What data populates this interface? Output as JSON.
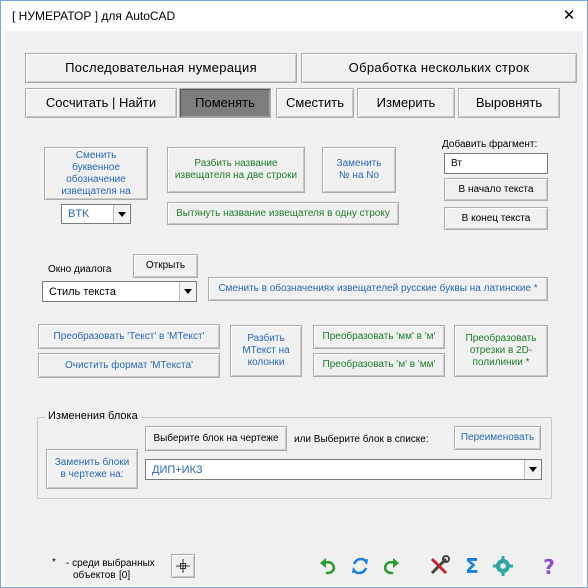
{
  "window": {
    "title": "[ НУМЕРАТОР ]  для AutoCAD",
    "close": "✕"
  },
  "top_buttons": {
    "sequential": "Последовательная  нумерация",
    "multiline": "Обработка  нескольких  строк"
  },
  "tabs": [
    {
      "label": "Сосчитать | Найти",
      "active": false
    },
    {
      "label": "Поменять",
      "active": true
    },
    {
      "label": "Сместить",
      "active": false
    },
    {
      "label": "Измерить",
      "active": false
    },
    {
      "label": "Выровнять",
      "active": false
    }
  ],
  "change_panel": {
    "change_letter": "Сменить буквенное обозначение извещателя на",
    "split_name": "Разбить название извещателя на две строки",
    "replace_num": "Заменить № на No",
    "letter_combo_value": "BTK",
    "pull_name": "Вытянуть название извещателя в одну строку"
  },
  "fragment": {
    "label": "Добавить фрагмент:",
    "value": "Вт",
    "to_start": "В начало текста",
    "to_end": "В конец текста"
  },
  "dialog": {
    "label": "Окно диалога",
    "open": "Открыть",
    "combo_value": "Стиль текста",
    "latin": "Сменить в обозначениях  извещателей русские буквы на латинские *"
  },
  "convert": {
    "text_to_mtext": "Преобразовать  'Текст' в 'МТекст'",
    "clear_format": "Очистить формат  'МТекста'",
    "split_mtext": "Разбить МТекст на колонки",
    "mm_to_m": "Преобразовать 'мм' в 'м'",
    "m_to_mm": "Преобразовать 'м' в 'мм'",
    "segments": "Преобразовать отрезки в 2D-полилинии *"
  },
  "block": {
    "group_title": "Изменения блока",
    "change_blocks": "Заменить блоки в чертеже на:",
    "pick_block": "Выберите блок на чертеже",
    "or_select": "или Выберите блок в списке:",
    "rename": "Переименовать",
    "combo_value": "ДИП+ИКЗ"
  },
  "footer": {
    "note_star": "*",
    "note_text": "- среди выбранных",
    "objects_label": "объектов",
    "objects_count": "[0]",
    "icons": [
      "select-objects-icon",
      "undo-icon",
      "refresh-icon",
      "redo-icon",
      "tools-icon",
      "sigma-icon",
      "gear-icon",
      "help-icon"
    ]
  },
  "colors": {
    "blue_text": "#2a6ab0",
    "green_text": "#1e7d2a",
    "icon_green": "#2f9a33",
    "icon_blue": "#1c7fd6",
    "icon_purple": "#8e4bd6",
    "pressed_tab": "#7d7d7d"
  }
}
